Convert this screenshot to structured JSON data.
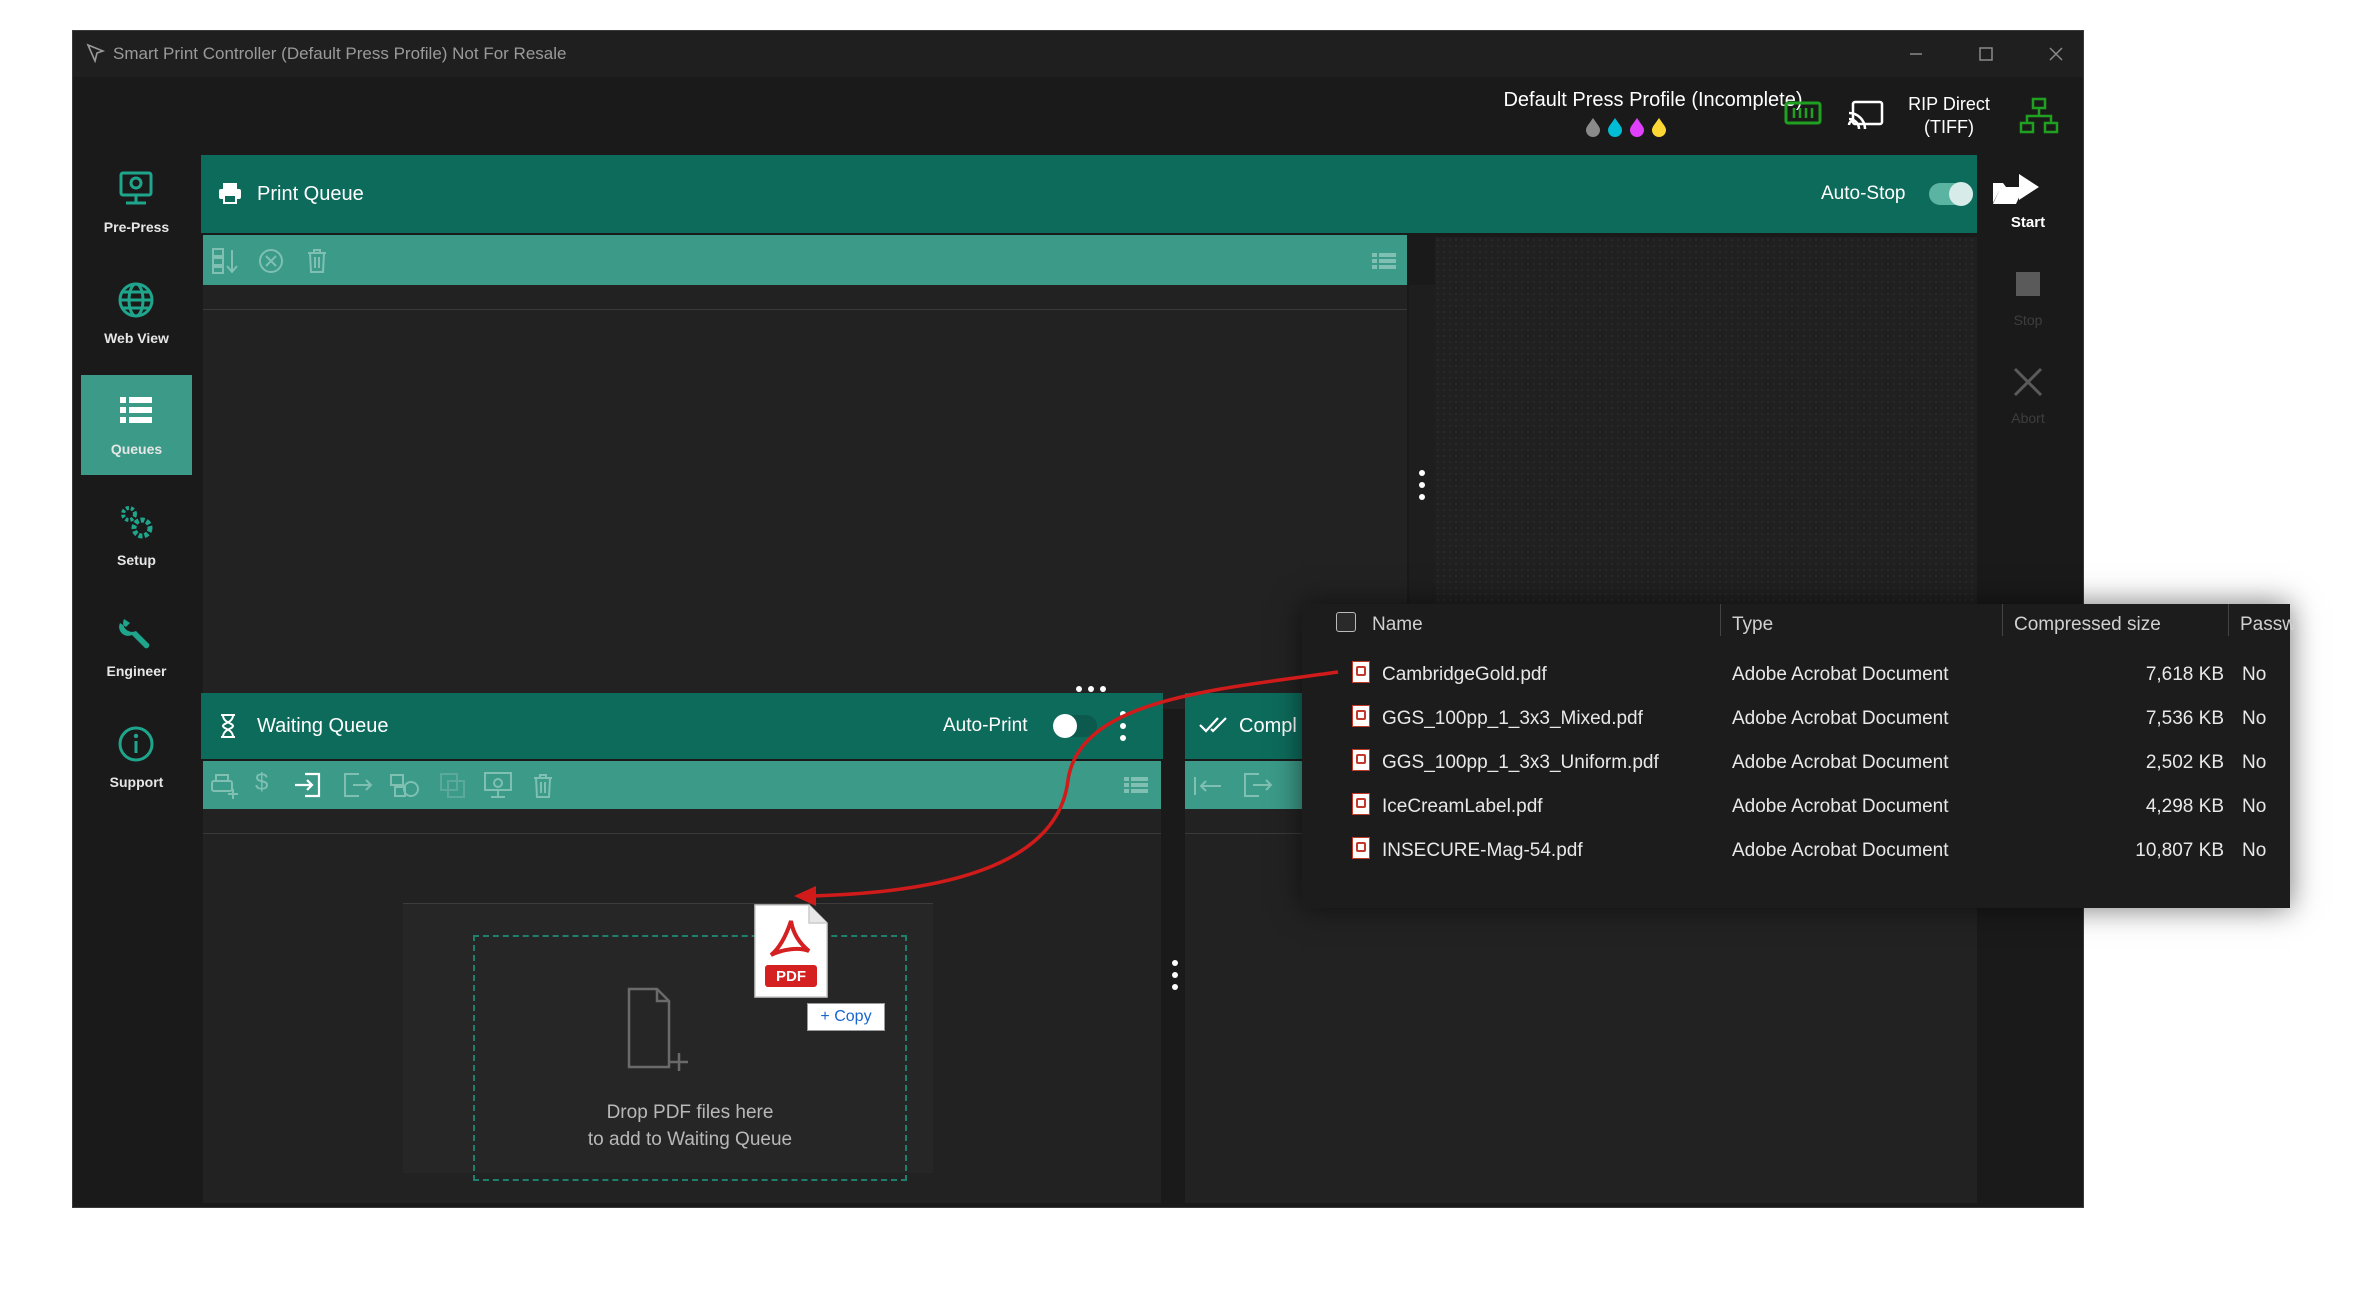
{
  "window": {
    "title": "Smart Print Controller (Default Press Profile) Not For Resale",
    "controls": [
      "minimize",
      "maximize",
      "close"
    ]
  },
  "header": {
    "profile_label": "Default Press Profile (Incomplete)",
    "ink_colors": [
      "#8a8a8a",
      "#00bcd4",
      "#e040fb",
      "#fdd835"
    ],
    "rip_line1": "RIP Direct",
    "rip_line2": "(TIFF)",
    "icons": [
      "printer-memory-icon",
      "cast-icon",
      "network-icon"
    ]
  },
  "sidebar": {
    "items": [
      {
        "label": "Pre-Press",
        "icon": "pre-press-icon",
        "active": false
      },
      {
        "label": "Web View",
        "icon": "globe-icon",
        "active": false
      },
      {
        "label": "Queues",
        "icon": "list-icon",
        "active": true
      },
      {
        "label": "Setup",
        "icon": "gears-icon",
        "active": false
      },
      {
        "label": "Engineer",
        "icon": "wrench-icon",
        "active": false
      },
      {
        "label": "Support",
        "icon": "info-icon",
        "active": false
      }
    ]
  },
  "print_queue": {
    "title": "Print Queue",
    "auto_stop_label": "Auto-Stop",
    "auto_stop_on": true
  },
  "waiting_queue": {
    "title": "Waiting Queue",
    "auto_print_label": "Auto-Print",
    "auto_print_on": false,
    "drop_line1": "Drop PDF files here",
    "drop_line2": "to add to Waiting Queue",
    "drag_badge_label": "PDF",
    "copy_label": "+ Copy"
  },
  "completed_queue": {
    "title": "Compl"
  },
  "controls": {
    "start_label": "Start",
    "stop_label": "Stop",
    "abort_label": "Abort"
  },
  "explorer": {
    "columns": [
      "Name",
      "Type",
      "Compressed size",
      "Passw"
    ],
    "rows": [
      {
        "name": "CambridgeGold.pdf",
        "type": "Adobe Acrobat Document",
        "size": "7,618 KB",
        "password": "No"
      },
      {
        "name": "GGS_100pp_1_3x3_Mixed.pdf",
        "type": "Adobe Acrobat Document",
        "size": "7,536 KB",
        "password": "No"
      },
      {
        "name": "GGS_100pp_1_3x3_Uniform.pdf",
        "type": "Adobe Acrobat Document",
        "size": "2,502 KB",
        "password": "No"
      },
      {
        "name": "IceCreamLabel.pdf",
        "type": "Adobe Acrobat Document",
        "size": "4,298 KB",
        "password": "No"
      },
      {
        "name": "INSECURE-Mag-54.pdf",
        "type": "Adobe Acrobat Document",
        "size": "10,807 KB",
        "password": "No"
      }
    ]
  },
  "colors": {
    "accent_dark": "#0d6b5b",
    "accent_light": "#3b9a88",
    "arrow": "#d11a1a"
  }
}
